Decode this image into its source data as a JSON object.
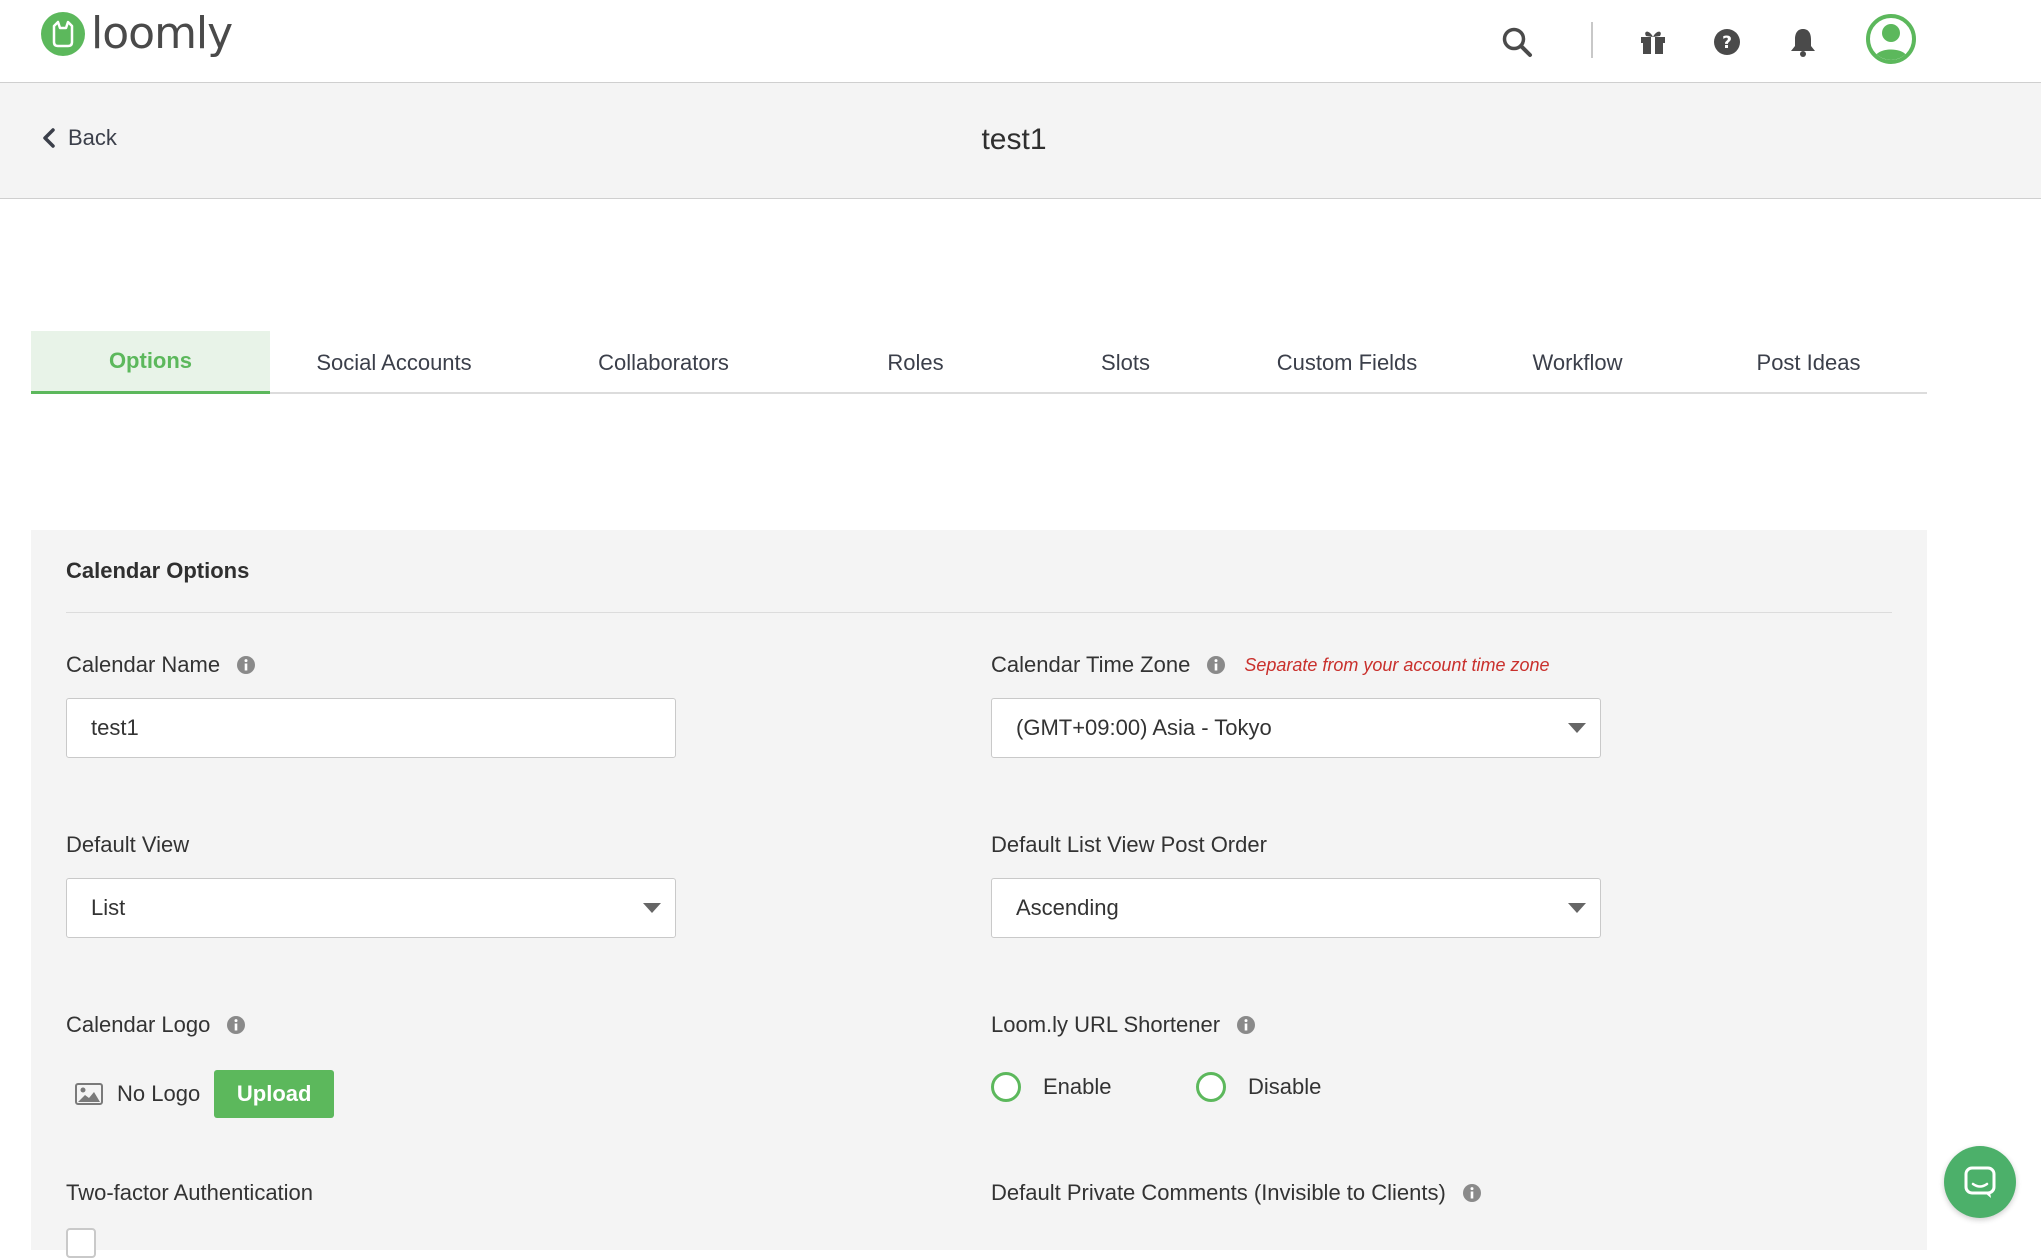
{
  "brand": {
    "name": "loomly",
    "accent_color": "#5cb85c"
  },
  "navbar": {
    "icons": [
      "search-icon",
      "gift-icon",
      "help-icon",
      "bell-icon",
      "user-avatar-icon"
    ]
  },
  "header": {
    "back_label": "Back",
    "title": "test1"
  },
  "tabs": [
    {
      "label": "Options",
      "active": true
    },
    {
      "label": "Social Accounts",
      "active": false
    },
    {
      "label": "Collaborators",
      "active": false
    },
    {
      "label": "Roles",
      "active": false
    },
    {
      "label": "Slots",
      "active": false
    },
    {
      "label": "Custom Fields",
      "active": false
    },
    {
      "label": "Workflow",
      "active": false
    },
    {
      "label": "Post Ideas",
      "active": false
    }
  ],
  "calendar_options": {
    "section_title": "Calendar Options",
    "calendar_name": {
      "label": "Calendar Name",
      "value": "test1"
    },
    "time_zone": {
      "label": "Calendar Time Zone",
      "hint": "Separate from your account time zone",
      "value": "(GMT+09:00) Asia - Tokyo"
    },
    "default_view": {
      "label": "Default View",
      "value": "List"
    },
    "post_order": {
      "label": "Default List View Post Order",
      "value": "Ascending"
    },
    "calendar_logo": {
      "label": "Calendar Logo",
      "status": "No Logo",
      "upload_label": "Upload"
    },
    "url_shortener": {
      "label": "Loom.ly URL Shortener",
      "enable_label": "Enable",
      "disable_label": "Disable"
    },
    "two_factor": {
      "label": "Two-factor Authentication"
    },
    "private_comments": {
      "label": "Default Private Comments (Invisible to Clients)"
    }
  }
}
